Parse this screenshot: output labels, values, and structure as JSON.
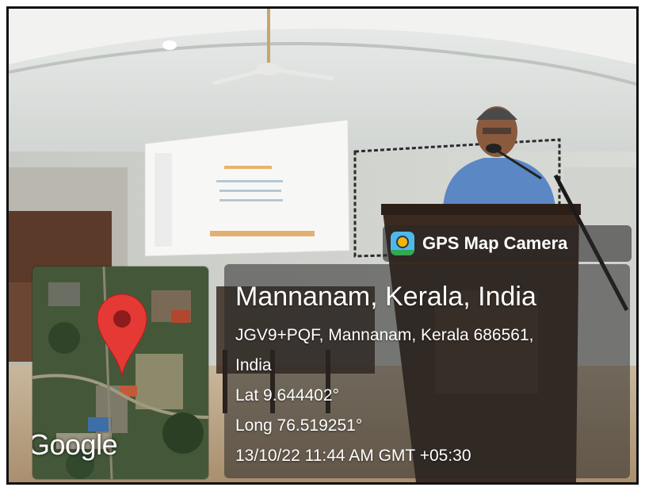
{
  "photo": {
    "description_icon": "photo-scene"
  },
  "map": {
    "brand": "Google",
    "pin_icon": "map-pin-icon",
    "pin_color": "#e53935"
  },
  "badge": {
    "label": "GPS Map Camera",
    "icon": "gps-map-camera-icon"
  },
  "location": {
    "title": "Mannanam, Kerala, India",
    "address_line1": "JGV9+PQF, Mannanam, Kerala 686561,",
    "address_line2": "India",
    "lat": "Lat 9.644402°",
    "long": "Long 76.519251°",
    "datetime": "13/10/22 11:44 AM GMT +05:30"
  }
}
